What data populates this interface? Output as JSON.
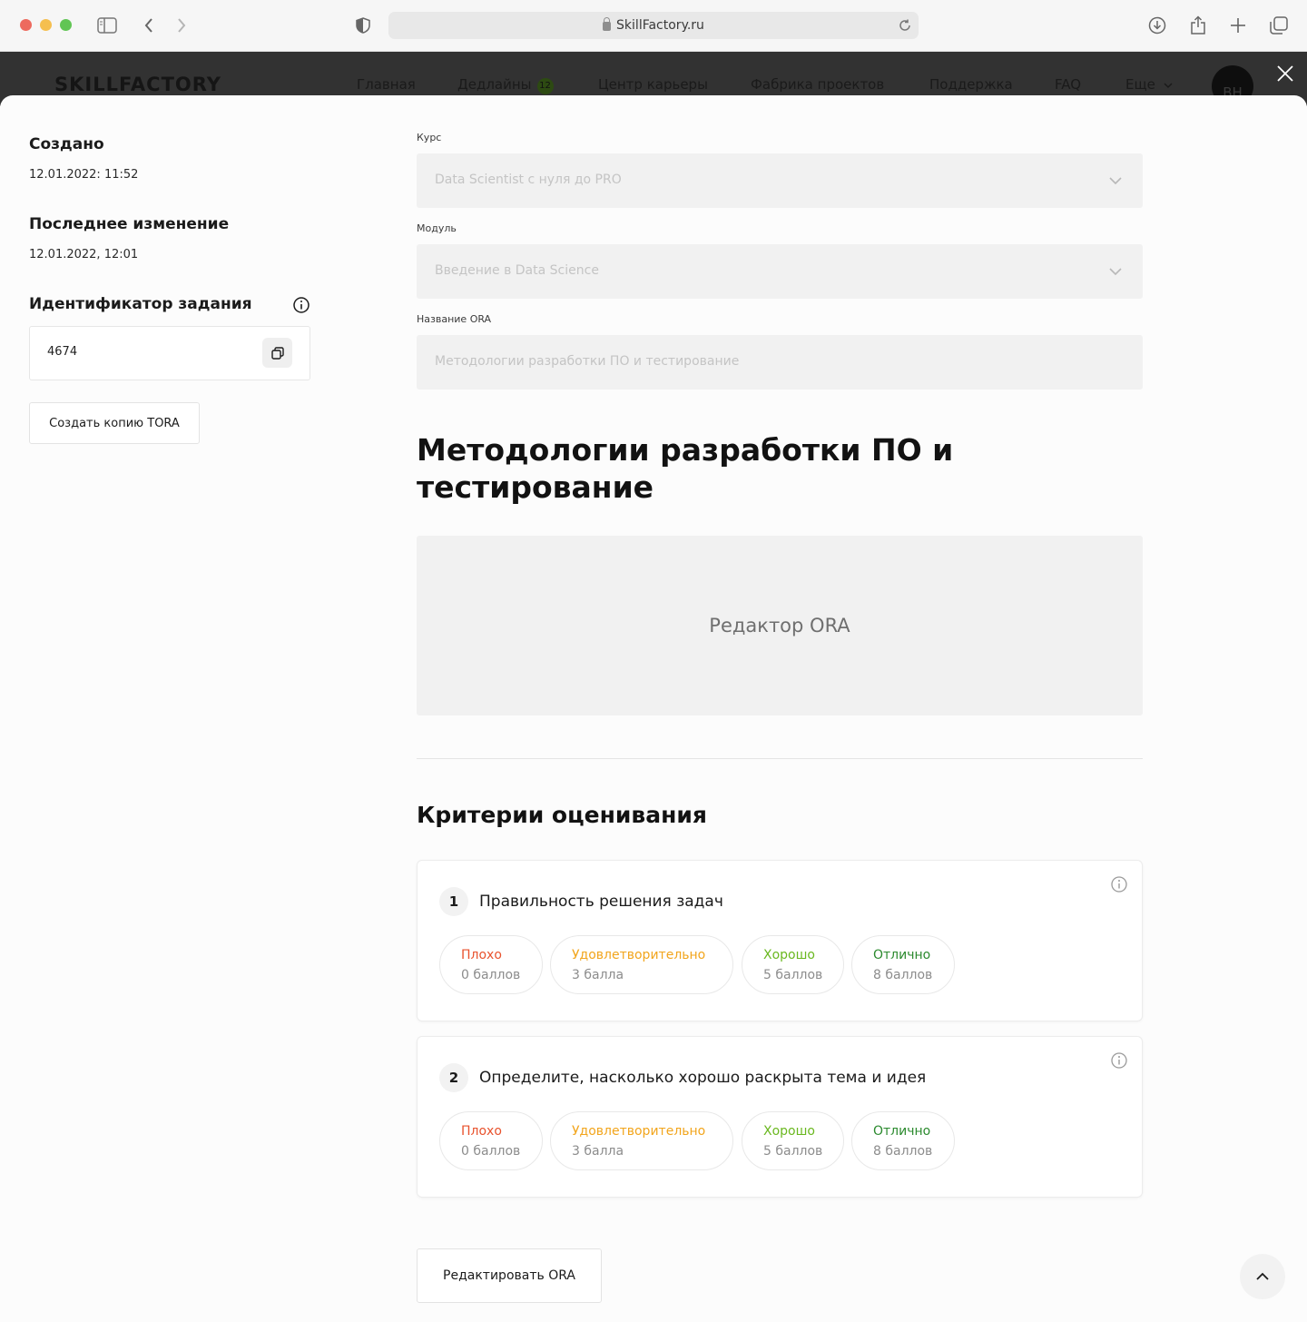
{
  "browser": {
    "url": "SkillFactory.ru"
  },
  "site": {
    "logo": "SKILLFACTORY",
    "nav": [
      {
        "label": "Главная"
      },
      {
        "label": "Дедлайны",
        "badge": "12"
      },
      {
        "label": "Центр карьеры"
      },
      {
        "label": "Фабрика проектов"
      },
      {
        "label": "Поддержка"
      },
      {
        "label": "FAQ"
      },
      {
        "label": "Еще"
      }
    ],
    "avatar_initials": "BH"
  },
  "sidebar": {
    "created_label": "Создано",
    "created_value": "12.01.2022: 11:52",
    "modified_label": "Последнее изменение",
    "modified_value": "12.01.2022, 12:01",
    "task_id_label": "Идентификатор задания",
    "task_id_value": "4674",
    "copy_button": "Создать копию TORA"
  },
  "form": {
    "course_label": "Курс",
    "course_value": "Data Scientist с нуля до PRO",
    "module_label": "Модуль",
    "module_value": "Введение в Data Science",
    "ora_name_label": "Название ORA",
    "ora_name_placeholder": "Методологии разработки ПО и тестирование"
  },
  "main": {
    "title": "Методологии разработки ПО и тестирование",
    "editor_placeholder": "Редактор ORA",
    "criteria_title": "Критерии оценивания",
    "edit_button": "Редактировать ORA"
  },
  "criteria": [
    {
      "number": "1",
      "title": "Правильность решения задач",
      "grades": [
        {
          "name": "Плохо",
          "points": "0 баллов"
        },
        {
          "name": "Удовлетворительно",
          "points": "3 балла"
        },
        {
          "name": "Хорошо",
          "points": "5 баллов"
        },
        {
          "name": "Отлично",
          "points": "8 баллов"
        }
      ]
    },
    {
      "number": "2",
      "title": "Определите, насколько хорошо раскрыта тема и идея",
      "grades": [
        {
          "name": "Плохо",
          "points": "0 баллов"
        },
        {
          "name": "Удовлетворительно",
          "points": "3 балла"
        },
        {
          "name": "Хорошо",
          "points": "5 баллов"
        },
        {
          "name": "Отлично",
          "points": "8 баллов"
        }
      ]
    }
  ],
  "colors": {
    "grade_bad": "#e8522d",
    "grade_ok": "#f2a51c",
    "grade_good": "#6ab81f",
    "grade_excellent": "#2b8a2e"
  }
}
